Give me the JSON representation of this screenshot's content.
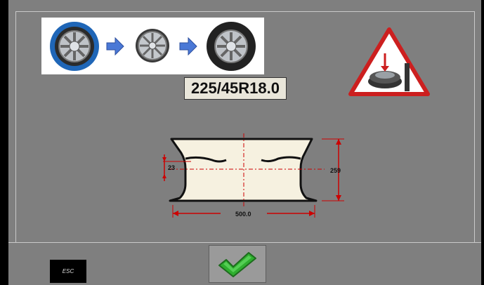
{
  "tire_size": "225/45R18.0",
  "rim": {
    "offset_value": "23",
    "height_value": "259",
    "width_value": "500.0"
  },
  "buttons": {
    "esc_label": "ESC"
  },
  "icons": {
    "process": [
      "wheel-with-tire-icon",
      "arrow-right-icon",
      "bare-rim-icon",
      "arrow-right-icon",
      "wheel-with-tire-icon"
    ],
    "warning": "tire-changer-warning-icon",
    "confirm": "checkmark-icon"
  },
  "colors": {
    "background": "#7f7f7f",
    "dimension_lines": "#cc0000",
    "rim_fill": "#f6f1e0",
    "confirm_green": "#2fae2f",
    "arrow_blue": "#4a78d6",
    "tire_blue": "#1f66b7"
  }
}
